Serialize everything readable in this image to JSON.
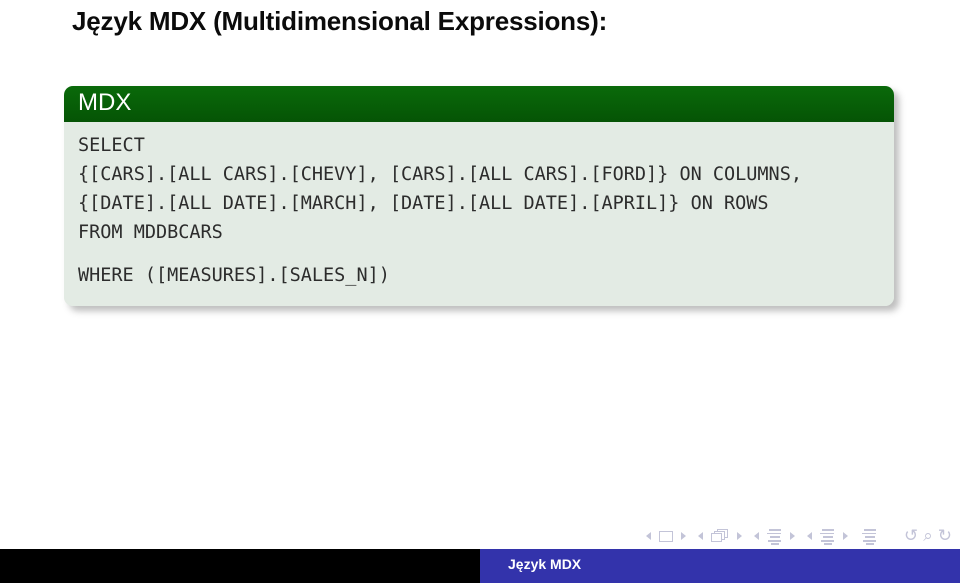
{
  "slide": {
    "title": "Język MDX (Multidimensional Expressions):"
  },
  "code_block": {
    "header_label": "MDX",
    "header_color": "#065c06",
    "body_background": "#e3ebe4",
    "code_color": "#2c2c2c",
    "lines": [
      "SELECT",
      "{[CARS].[ALL CARS].[CHEVY], [CARS].[ALL CARS].[FORD]} ON COLUMNS,",
      "{[DATE].[ALL DATE].[MARCH], [DATE].[ALL DATE].[APRIL]} ON ROWS",
      "FROM MDDBCARS",
      "WHERE ([MEASURES].[SALES_N])"
    ]
  },
  "navigation": {
    "slide_prev_label": "◄",
    "slide_next_label": "►",
    "slide_icon": "slide-icon",
    "frame_prev_label": "◄",
    "frame_next_label": "►",
    "frame_icon": "frames-icon",
    "subsection_prev_label": "◄",
    "subsection_next_label": "►",
    "subsection_icon": "subsection-icon",
    "section_prev_label": "◄",
    "section_next_label": "►",
    "section_icon": "section-icon",
    "presentation_icon": "presentation-icon",
    "back_glyph": "↺",
    "search_glyph": "⌕",
    "forward_glyph": "↻",
    "icon_color": "#c3c4d8"
  },
  "footer": {
    "left_color": "#000000",
    "right_color": "#3333ab",
    "text": "Język MDX"
  }
}
